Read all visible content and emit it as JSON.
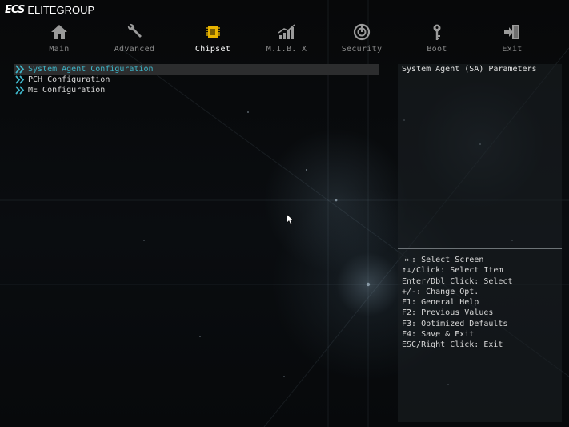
{
  "brand": {
    "logo": "ECS",
    "name": "ELITEGROUP"
  },
  "tabs": [
    {
      "label": "Main",
      "icon": "home-icon"
    },
    {
      "label": "Advanced",
      "icon": "wrench-icon"
    },
    {
      "label": "Chipset",
      "icon": "chip-icon",
      "active": true
    },
    {
      "label": "M.I.B. X",
      "icon": "chart-icon"
    },
    {
      "label": "Security",
      "icon": "power-icon"
    },
    {
      "label": "Boot",
      "icon": "key-icon"
    },
    {
      "label": "Exit",
      "icon": "exit-icon"
    }
  ],
  "menu": {
    "items": [
      {
        "label": "System Agent Configuration",
        "selected": true
      },
      {
        "label": "PCH Configuration"
      },
      {
        "label": "ME Configuration"
      }
    ]
  },
  "help": {
    "title": "System Agent (SA) Parameters",
    "keys": [
      "→←: Select Screen",
      "↑↓/Click: Select Item",
      "Enter/Dbl Click: Select",
      "+/-: Change Opt.",
      "F1: General Help",
      "F2: Previous Values",
      "F3: Optimized Defaults",
      "F4: Save & Exit",
      "ESC/Right Click: Exit"
    ]
  },
  "colors": {
    "selected_text": "#3fb5c8",
    "selected_bg": "#2c2d2e",
    "chipset_icon": "#e8b400",
    "inactive_tab": "#8a8a8a"
  }
}
